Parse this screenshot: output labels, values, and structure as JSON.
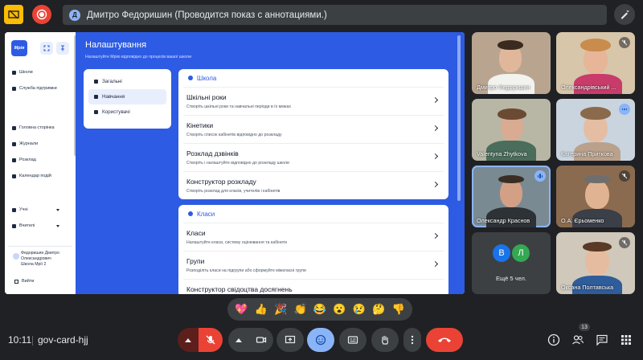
{
  "window": {
    "presenter_initial": "Д",
    "presenter_label": "Дмитро Федоришин (Проводится показ с аннотациями.)"
  },
  "shared_app": {
    "logo_text": "Мрія",
    "sidebar": {
      "items": [
        {
          "label": "Школи",
          "icon": "school-icon"
        },
        {
          "label": "Служба підтримки",
          "icon": "headset-icon"
        },
        {
          "label": "Головна сторінка",
          "icon": "home-icon"
        },
        {
          "label": "Журнали",
          "icon": "journal-icon"
        },
        {
          "label": "Розклад",
          "icon": "calendar-icon"
        },
        {
          "label": "Календар подій",
          "icon": "calendar-icon"
        },
        {
          "label": "Учні",
          "icon": "students-icon"
        },
        {
          "label": "Вчителі",
          "icon": "teachers-icon"
        }
      ],
      "user_name": "Федоришин Дмитро Олександрович",
      "user_school": "Школа Мрії 2",
      "exit_label": "Вийти"
    },
    "page_title": "Налаштування",
    "page_subtitle": "Налаштуйте Мрію відповідно до процесів вашої школи",
    "settings_nav": [
      {
        "label": "Загальні",
        "active": false
      },
      {
        "label": "Навчання",
        "active": true
      },
      {
        "label": "Користувачі",
        "active": false
      }
    ],
    "school_card": {
      "title": "Школа",
      "rows": [
        {
          "title": "Шкільні роки",
          "desc": "Створіть шкільні роки та навчальні періоди в їх межах"
        },
        {
          "title": "Кінетики",
          "desc": "Створіть список кабінетів відповідно до розкладу"
        },
        {
          "title": "Розклад дзвінків",
          "desc": "Створіть і налаштуйте відповідно до розкладу школи"
        },
        {
          "title": "Конструктор розкладу",
          "desc": "Створіть розклад для класів, учителів і кабінетів"
        }
      ]
    },
    "classes_card": {
      "title": "Класи",
      "rows": [
        {
          "title": "Класи",
          "desc": "Налаштуйте класи, систему оцінювання та кабінети"
        },
        {
          "title": "Групи",
          "desc": "Розподіліть класи на підгрупи або сформуйте міжкласні групи"
        },
        {
          "title": "Конструктор свідоцтва досягнень",
          "desc": ""
        }
      ]
    }
  },
  "participants": [
    {
      "name": "Дмитро Федоришин",
      "mic": "none"
    },
    {
      "name": "Олександрівський ...",
      "mic": "off"
    },
    {
      "name": "Valentyna Zhytkova",
      "mic": "none"
    },
    {
      "name": "Катерина Приткова",
      "mic": "dots"
    },
    {
      "name": "Олександр Краснов",
      "mic": "speaking"
    },
    {
      "name": "О.А. Єрьоменко",
      "mic": "off"
    },
    {
      "name": "Оксана Полтавська",
      "mic": "off"
    }
  ],
  "more_tile": {
    "bubbles": [
      {
        "letter": "В",
        "color": "#1a73e8"
      },
      {
        "letter": "Л",
        "color": "#34a853"
      }
    ],
    "label": "Ещё 5 чел."
  },
  "reactions": [
    "💖",
    "👍",
    "🎉",
    "👏",
    "😂",
    "😮",
    "😢",
    "🤔",
    "👎"
  ],
  "bottom": {
    "time": "10:11",
    "meeting_code": "gov-card-hjj",
    "participant_count": "13"
  },
  "colors": {
    "accent": "#2d5be3",
    "hangup": "#ea4335",
    "active_control": "#8ab4f8"
  }
}
